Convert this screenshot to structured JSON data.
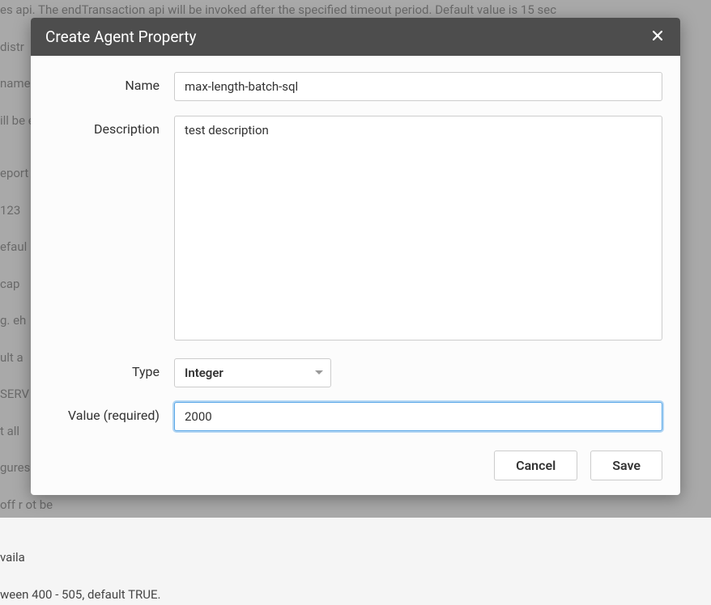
{
  "background_lines": [
    "es api. The endTransaction api will be invoked after the specified timeout period. Default value is 15 sec",
    " distr",
    " name",
    "ill be                                                                                                                                                                                                                                             e of",
    "",
    "eport                                                                                                                                                                                                                                           ls res",
    "123",
    "efaul",
    " cap",
    "g. eh",
    "ult a",
    "SERV                                                                                                                                                                                                                                            be co",
    "t all",
    "gures                                                                                                                                                                                                                                          l a re",
    " off r                                                                                                                                                                                                                                            ot be",
    "",
    "vaila",
    "ween 400 - 505, default TRUE."
  ],
  "modal": {
    "title": "Create Agent Property",
    "close_label": "✕",
    "fields": {
      "name": {
        "label": "Name",
        "value": "max-length-batch-sql"
      },
      "description": {
        "label": "Description",
        "value": "test description"
      },
      "type": {
        "label": "Type",
        "value": "Integer"
      },
      "value": {
        "label": "Value (required)",
        "value": "2000"
      }
    },
    "buttons": {
      "cancel": "Cancel",
      "save": "Save"
    }
  }
}
